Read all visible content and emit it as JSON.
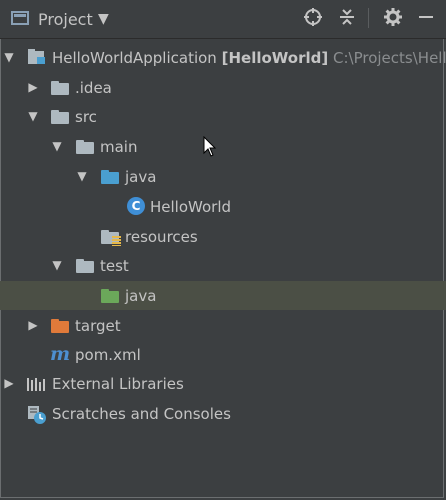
{
  "header": {
    "title": "Project",
    "icons": [
      "locate-target-icon",
      "collapse-all-icon",
      "gear-icon",
      "hide-panel-icon"
    ]
  },
  "tree": {
    "root": {
      "name": "HelloWorldApplication",
      "module": "[HelloWorld]",
      "path": "C:\\Projects\\Hello"
    },
    "idea": ".idea",
    "src": "src",
    "main": "main",
    "java_main": "java",
    "hello_world": "HelloWorld",
    "resources": "resources",
    "test": "test",
    "java_test": "java",
    "target": "target",
    "pom": "pom.xml",
    "external_libraries": "External Libraries",
    "scratches": "Scratches and Consoles"
  },
  "colors": {
    "background": "#3c3f41",
    "selected_row": "#4b4f45",
    "source_folder": "#4a9fd0",
    "test_folder": "#6ba85a",
    "excluded_folder": "#e07a3a"
  }
}
